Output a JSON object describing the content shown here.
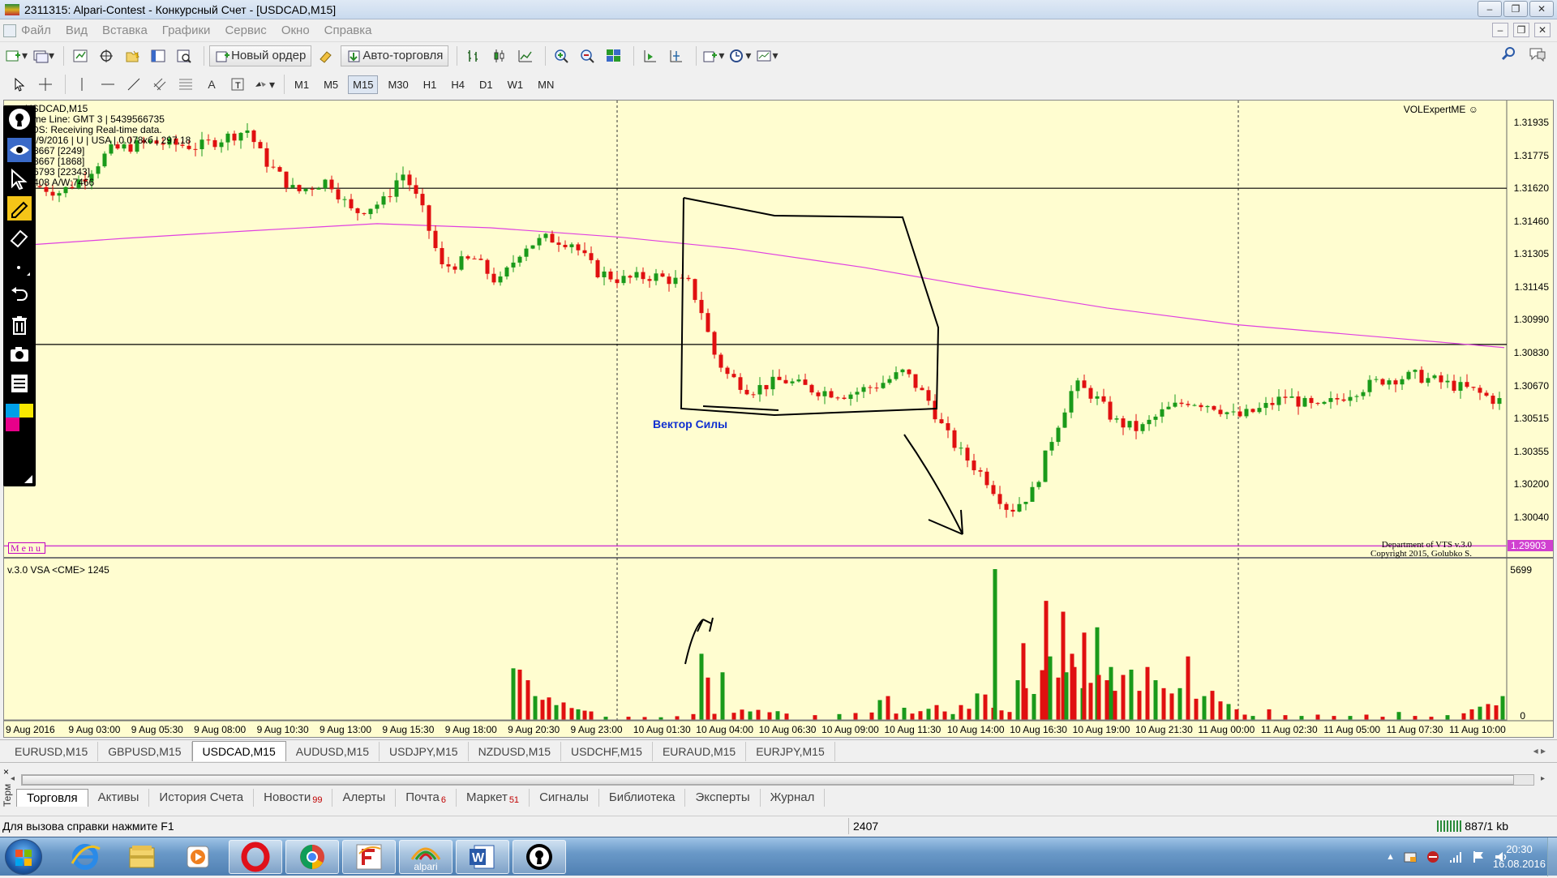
{
  "window": {
    "title": "2311315: Alpari-Contest - Конкурсный Счет - [USDCAD,M15]",
    "controls": [
      "‒",
      "❐",
      "✕"
    ]
  },
  "menu": {
    "items": [
      "Файл",
      "Вид",
      "Вставка",
      "Графики",
      "Сервис",
      "Окно",
      "Справка"
    ]
  },
  "toolbar": {
    "new_order": "Новый ордер",
    "auto_trading": "Авто-торговля"
  },
  "timeframes": [
    "M1",
    "M5",
    "M15",
    "M30",
    "H1",
    "H4",
    "D1",
    "W1",
    "MN"
  ],
  "active_timeframe": "M15",
  "chart": {
    "info_lines": [
      "USDCAD,M15",
      "Time Line: GMT 3 | 5439566735",
      "VDS:  Receiving Real-time data.",
      "15/9/2016 | U | USA | 0.078кб | 297,18",
      "...8667  [2249]",
      "...8667  [1868]",
      "...6793  [22343]",
      "...408  A/W:7466"
    ],
    "expert": "VOLExpertME ☺",
    "menu_label": "Menu",
    "annotation": "Вектор Силы",
    "dept_line1": "Department of VTS  v.3.0",
    "dept_line2": "Copyright 2015, Golubko S.",
    "current_price": "1.29903",
    "price_labels": [
      "1.31935",
      "1.31775",
      "1.31620",
      "1.31460",
      "1.31305",
      "1.31145",
      "1.30990",
      "1.30830",
      "1.30670",
      "1.30515",
      "1.30355",
      "1.30200",
      "1.30040"
    ],
    "price_min": 1.2992,
    "price_max": 1.3201,
    "hlines": [
      1.3162,
      1.3087
    ],
    "vsa_label": "v.3.0 VSA <CME> 1245",
    "vol_max_label": "5699",
    "vol_zero_label": "0",
    "time_labels": [
      "9 Aug 2016",
      "9 Aug 03:00",
      "9 Aug 05:30",
      "9 Aug 08:00",
      "9 Aug 10:30",
      "9 Aug 13:00",
      "9 Aug 15:30",
      "9 Aug 18:00",
      "9 Aug 20:30",
      "9 Aug 23:00",
      "10 Aug 01:30",
      "10 Aug 04:00",
      "10 Aug 06:30",
      "10 Aug 09:00",
      "10 Aug 11:30",
      "10 Aug 14:00",
      "10 Aug 16:30",
      "10 Aug 19:00",
      "10 Aug 21:30",
      "11 Aug 00:00",
      "11 Aug 02:30",
      "11 Aug 05:00",
      "11 Aug 07:30",
      "11 Aug 10:00"
    ]
  },
  "symbol_tabs": [
    "EURUSD,M15",
    "GBPUSD,M15",
    "USDCAD,M15",
    "AUDUSD,M15",
    "USDJPY,M15",
    "NZDUSD,M15",
    "USDCHF,M15",
    "EURAUD,M15",
    "EURJPY,M15"
  ],
  "active_symbol": "USDCAD,M15",
  "terminal": {
    "side_label": "Терм",
    "close": "×",
    "tabs": [
      {
        "label": "Торговля",
        "badge": ""
      },
      {
        "label": "Активы",
        "badge": ""
      },
      {
        "label": "История Счета",
        "badge": ""
      },
      {
        "label": "Новости",
        "badge": "99"
      },
      {
        "label": "Алерты",
        "badge": ""
      },
      {
        "label": "Почта",
        "badge": "6"
      },
      {
        "label": "Маркет",
        "badge": "51"
      },
      {
        "label": "Сигналы",
        "badge": ""
      },
      {
        "label": "Библиотека",
        "badge": ""
      },
      {
        "label": "Эксперты",
        "badge": ""
      },
      {
        "label": "Журнал",
        "badge": ""
      }
    ]
  },
  "status": {
    "help": "Для вызова справки нажмите F1",
    "count": "2407",
    "net": "887/1 kb"
  },
  "taskbar": {
    "apps": [
      "ie-icon",
      "explorer-icon",
      "media-player-icon",
      "opera-icon",
      "chrome-icon",
      "f-app-icon",
      "alpari-icon",
      "word-icon",
      "keyhole-icon"
    ],
    "alpari_text": "alpari",
    "time": "20:30",
    "date": "16.08.2016"
  },
  "colors": {
    "chart_bg": "#fffdd0",
    "bull": "#1a9a1a",
    "bear": "#e01010",
    "ma": "#e040e0",
    "current_price": "#d040d0"
  }
}
